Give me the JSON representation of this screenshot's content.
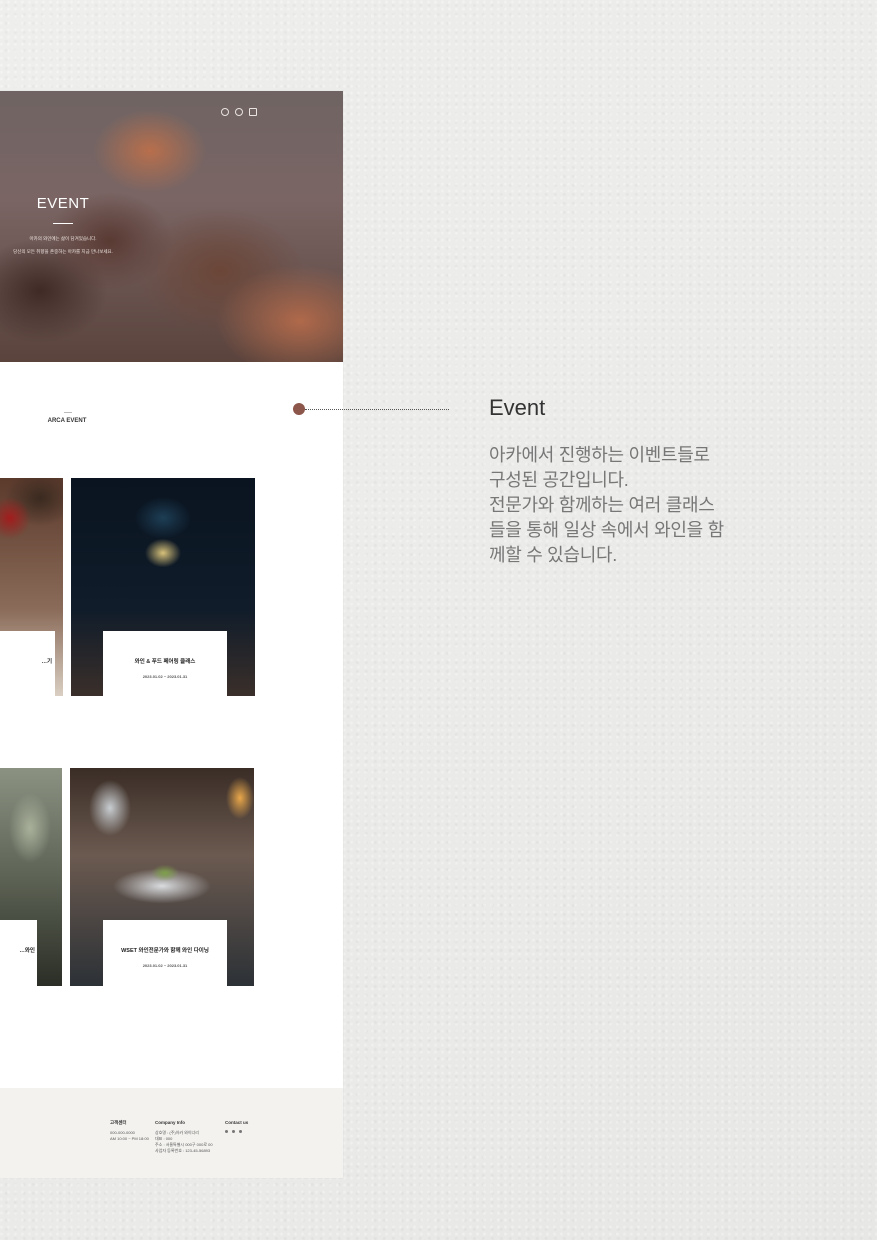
{
  "hero": {
    "title": "EVENT",
    "subtitle_line1": "아카의 와인에는 삶이 담겨있습니다.",
    "subtitle_line2": "당신의 모든 취향을 존중하는 아카를 지금 만나보세요."
  },
  "header_icons": [
    "search-icon",
    "user-icon",
    "bag-icon"
  ],
  "section": {
    "title": "ARCA EVENT"
  },
  "events": [
    {
      "title": "와인 & 푸드 페어링 클래스",
      "date": "2023.01.02 ~ 2023.01.31"
    },
    {
      "title": "…기",
      "date": ""
    },
    {
      "title": "…와인",
      "date": ""
    },
    {
      "title": "WSET 와인전문가와 함께 와인 다이닝",
      "date": "2023.01.02 ~ 2023.01.31"
    }
  ],
  "footer": {
    "col1_title": "고객센터",
    "col1_lines": [
      "000-000-0000",
      "AM 10:00 ~ PM 18:00"
    ],
    "col2_title": "Company Info",
    "col2_lines": [
      "상호명 : (주)아카 와이너리",
      "대표 : 000",
      "주소 : 서울특별시 000구 000로 00",
      "사업자 등록번호 : 123-45-56893"
    ],
    "col3_title": "Contact us",
    "social_icons": [
      "instagram-icon",
      "facebook-icon",
      "blog-icon"
    ]
  },
  "info": {
    "title": "Event",
    "description_lines": [
      "아카에서 진행하는 이벤트들로",
      "구성된 공간입니다.",
      "전문가와 함께하는 여러 클래스",
      "들을 통해 일상 속에서 와인을 함",
      "께할 수 있습니다."
    ]
  },
  "colors": {
    "accent": "#8d564a",
    "background": "#ececea",
    "footer_bg": "#f3f2ef"
  }
}
